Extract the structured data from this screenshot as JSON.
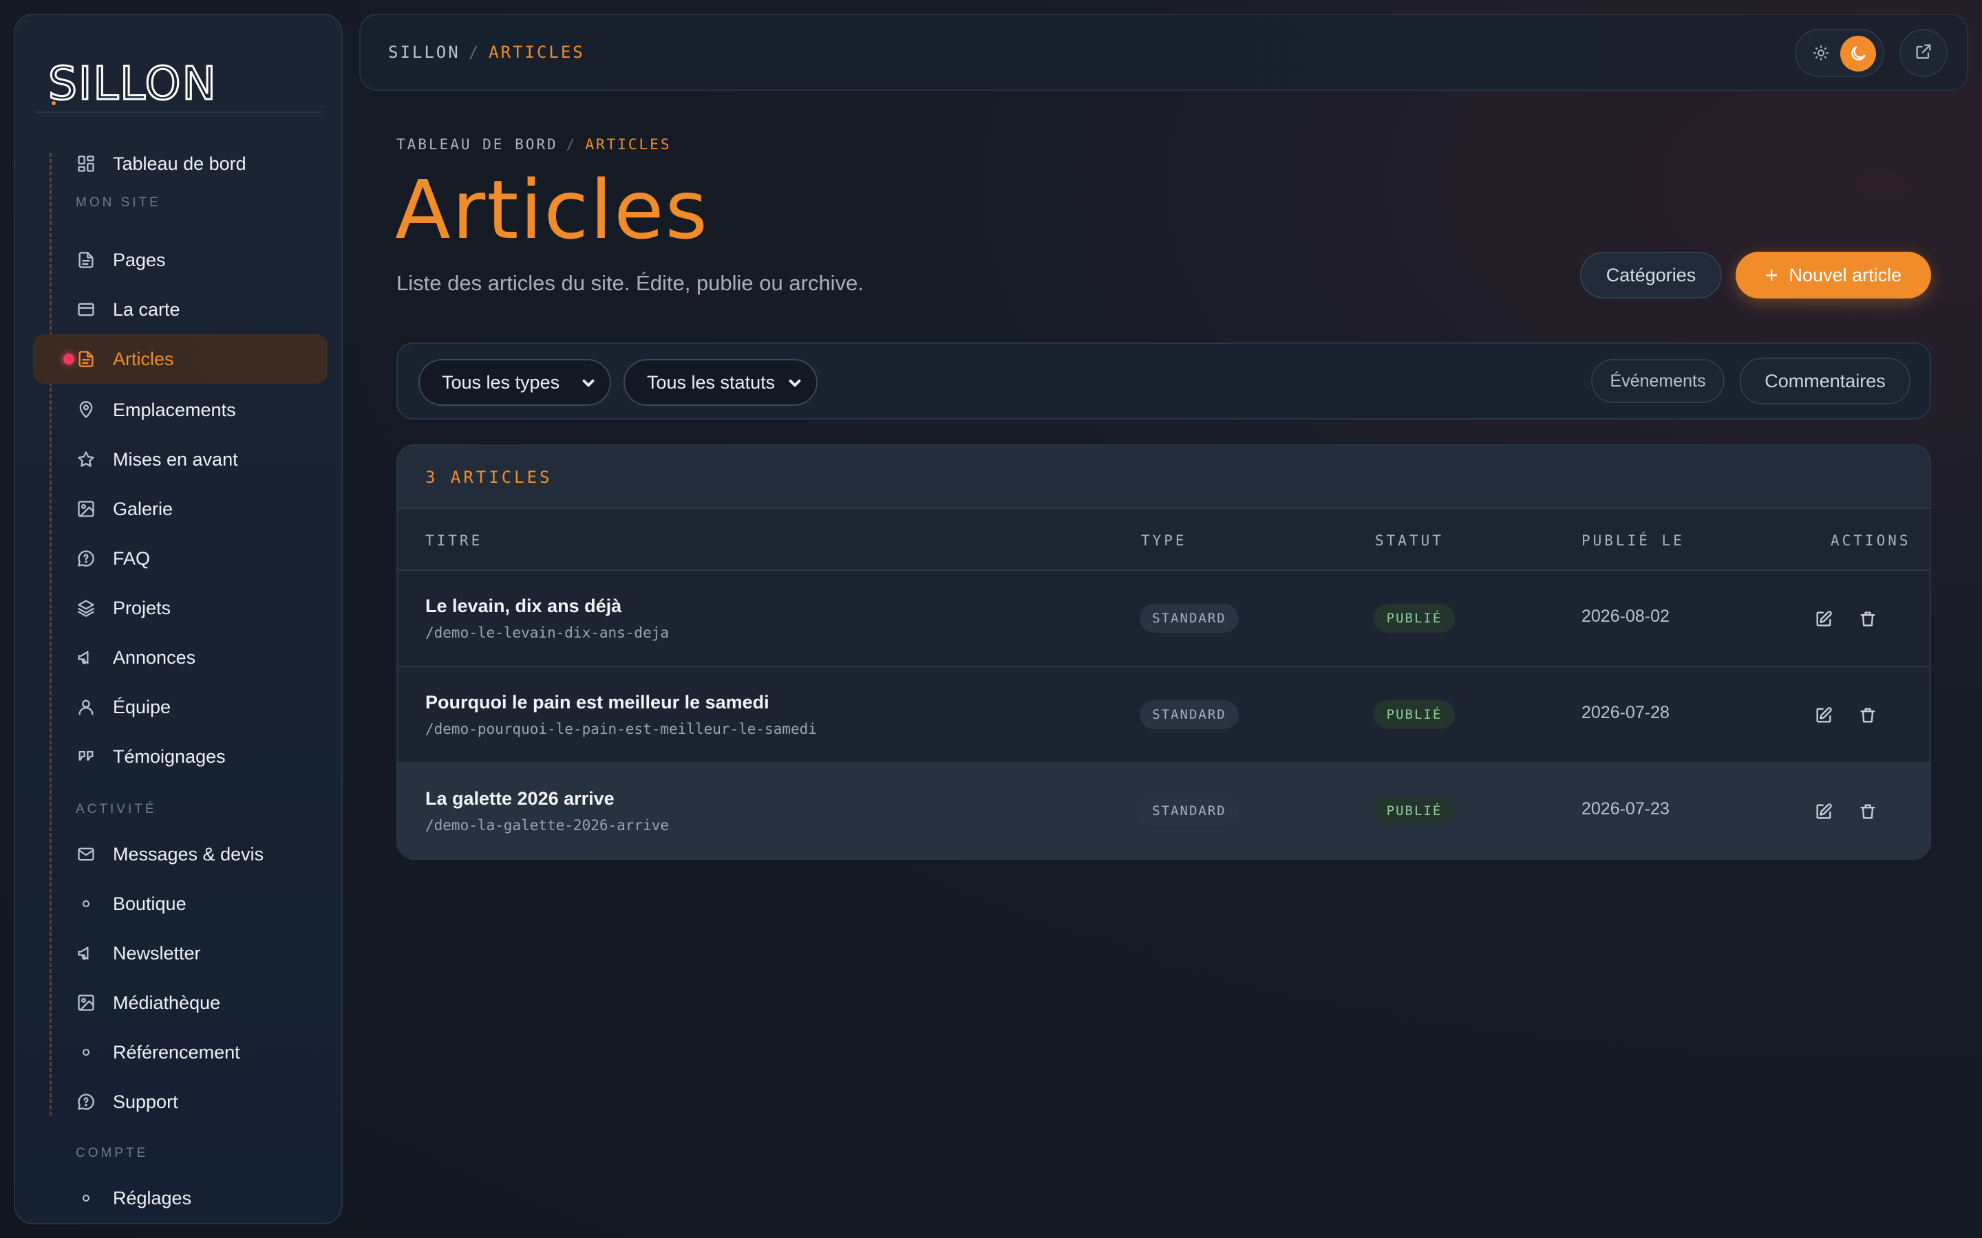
{
  "sidebar": {
    "logo_text": "SILLON",
    "dashboard": "Tableau de bord",
    "section_site": "MON SITE",
    "site_items": [
      "Pages",
      "La carte",
      "Articles",
      "Emplacements",
      "Mises en avant",
      "Galerie",
      "FAQ",
      "Projets",
      "Annonces",
      "Équipe",
      "Témoignages"
    ],
    "section_activity": "ACTIVITÉ",
    "activity_items": [
      "Messages & devis",
      "Boutique",
      "Newsletter",
      "Médiathèque",
      "Référencement",
      "Support"
    ],
    "section_account": "COMPTE",
    "account_items": [
      "Réglages"
    ]
  },
  "topbar": {
    "crumb_root": "SILLON",
    "crumb_sep": "/",
    "crumb_current": "ARTICLES"
  },
  "header": {
    "crumb_root": "TABLEAU DE BORD",
    "crumb_sep": "/",
    "crumb_current": "ARTICLES",
    "title": "Articles",
    "description": "Liste des articles du site. Édite, publie ou archive.",
    "categories_label": "Catégories",
    "new_label": "Nouvel article",
    "new_icon": "+"
  },
  "filters": {
    "type_select": "Tous les types",
    "status_select": "Tous les statuts",
    "events_label": "Événements",
    "comments_label": "Commentaires"
  },
  "table": {
    "count_label": "3 ARTICLES",
    "columns": [
      "TITRE",
      "TYPE",
      "STATUT",
      "PUBLIÉ LE",
      "ACTIONS"
    ],
    "rows": [
      {
        "title": "Le levain, dix ans déjà",
        "slug": "/demo-le-levain-dix-ans-deja",
        "type": "STANDARD",
        "status": "PUBLIÉ",
        "date": "2026-08-02"
      },
      {
        "title": "Pourquoi le pain est meilleur le samedi",
        "slug": "/demo-pourquoi-le-pain-est-meilleur-le-samedi",
        "type": "STANDARD",
        "status": "PUBLIÉ",
        "date": "2026-07-28"
      },
      {
        "title": "La galette 2026 arrive",
        "slug": "/demo-la-galette-2026-arrive",
        "type": "STANDARD",
        "status": "PUBLIÉ",
        "date": "2026-07-23"
      }
    ]
  },
  "colors": {
    "accent": "#f08c2a",
    "active_dot": "#ef3a5d",
    "status_green": "#8fcc9a"
  }
}
